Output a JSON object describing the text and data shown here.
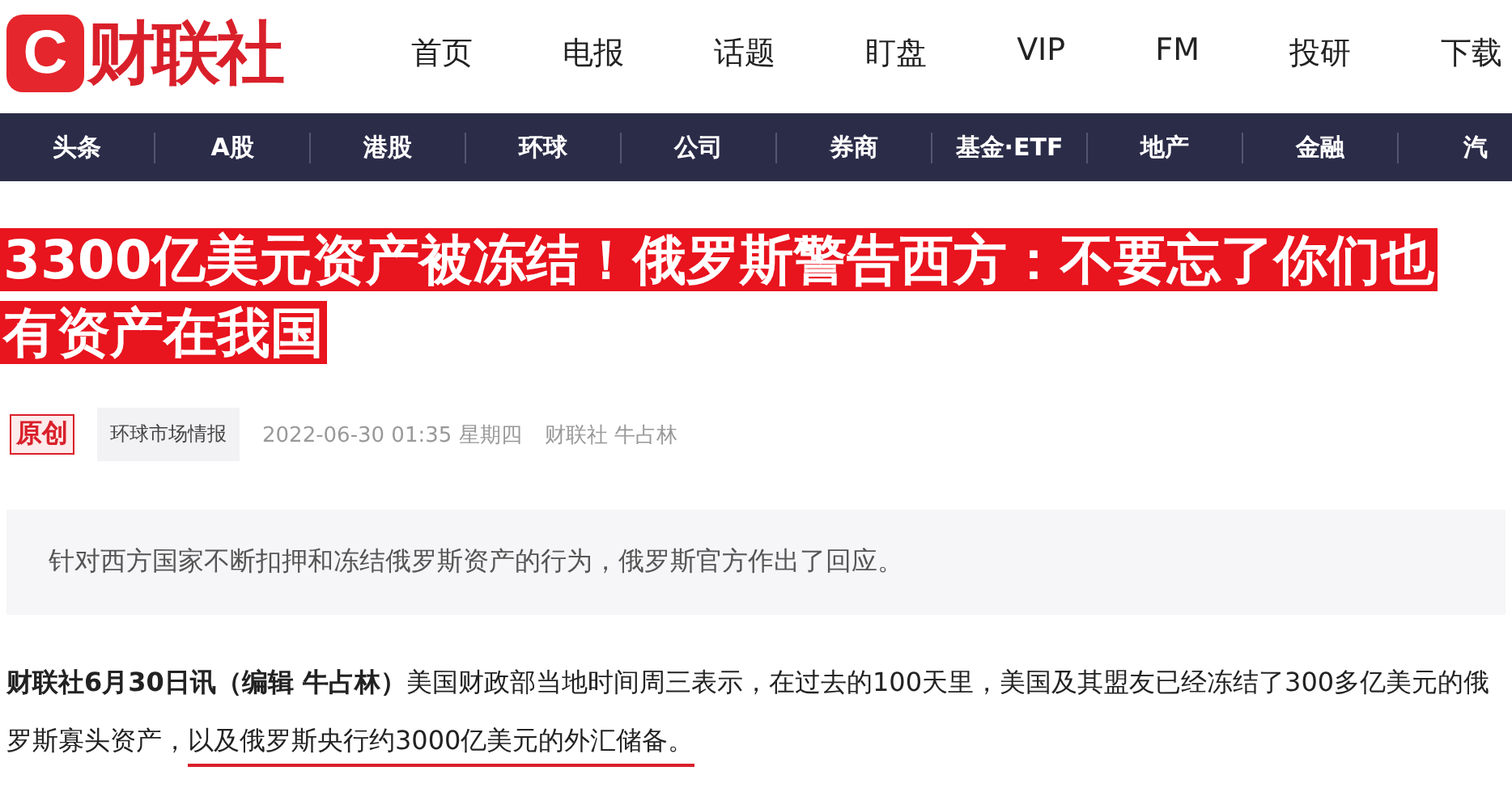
{
  "logo": {
    "mark": "C",
    "name": "财联社"
  },
  "top_nav": [
    "首页",
    "电报",
    "话题",
    "盯盘",
    "VIP",
    "FM",
    "投研",
    "下载"
  ],
  "channel_nav": [
    "头条",
    "A股",
    "港股",
    "环球",
    "公司",
    "券商",
    "基金·ETF",
    "地产",
    "金融",
    "汽"
  ],
  "headline": [
    "3300亿美元资产被冻结！俄罗斯警告西方：不要忘了你们也",
    "有资产在我国"
  ],
  "meta": {
    "badge": "原创",
    "tag": "环球市场情报",
    "datetime": "2022-06-30 01:35 星期四",
    "source": "财联社 牛占林"
  },
  "summary": "针对西方国家不断扣押和冻结俄罗斯资产的行为，俄罗斯官方作出了回应。",
  "paragraph": [
    {
      "text": "财联社6月30日讯（编辑 牛占林）",
      "bold": true,
      "underlined": false
    },
    {
      "text": "美国财政部当地时间周三表示，在过去的100天里，美国及其盟友已经冻结了3",
      "bold": false,
      "underlined": false
    },
    {
      "text": "00多亿美元的俄罗斯寡头资产，",
      "bold": false,
      "underlined": false
    },
    {
      "text": "以及俄罗斯央行约3000亿美元的外汇储备。",
      "bold": false,
      "underlined": true
    }
  ]
}
